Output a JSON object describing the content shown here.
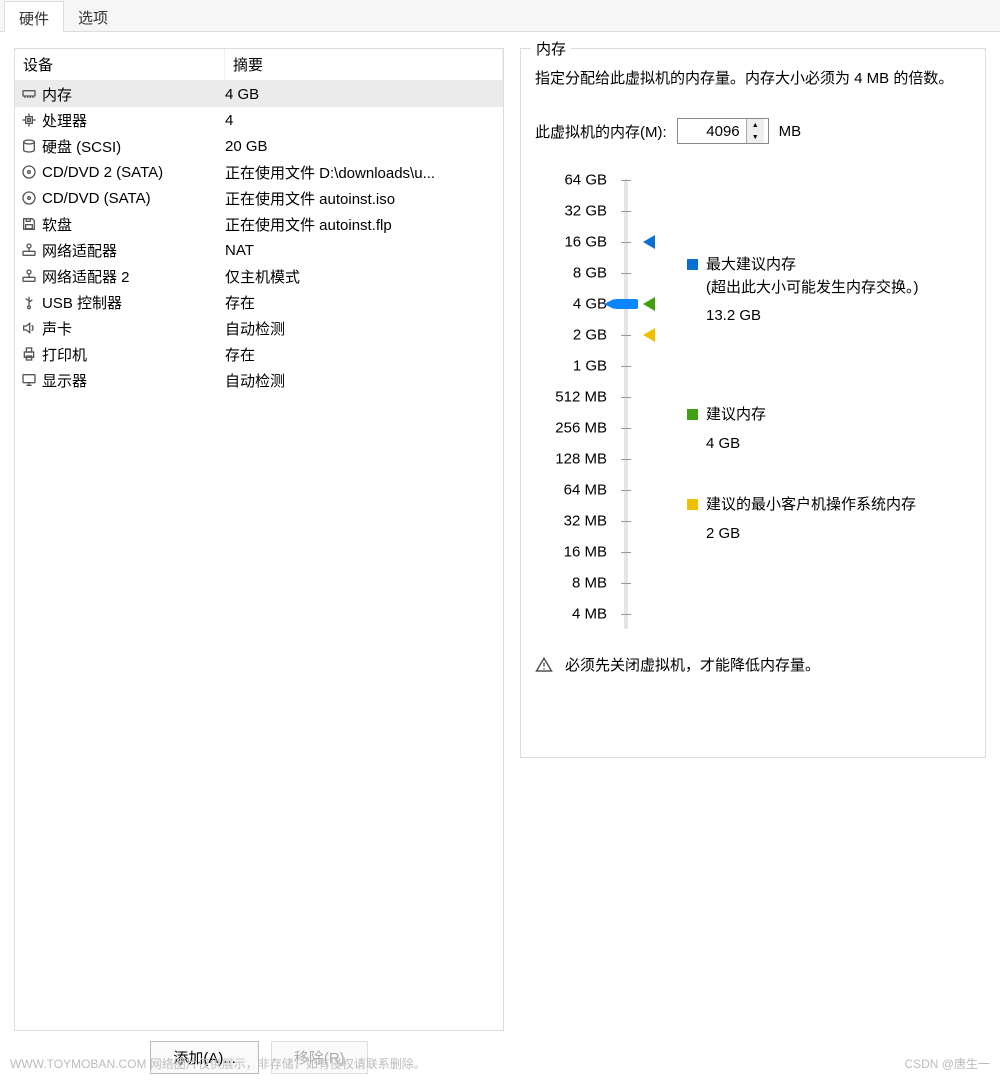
{
  "tabs": {
    "hardware": "硬件",
    "options": "选项"
  },
  "hw_headers": {
    "device": "设备",
    "summary": "摘要"
  },
  "hardware": [
    {
      "icon": "memory-icon",
      "name": "内存",
      "summary": "4 GB",
      "selected": true
    },
    {
      "icon": "cpu-icon",
      "name": "处理器",
      "summary": "4"
    },
    {
      "icon": "disk-icon",
      "name": "硬盘 (SCSI)",
      "summary": "20 GB"
    },
    {
      "icon": "cd-icon",
      "name": "CD/DVD 2 (SATA)",
      "summary": "正在使用文件 D:\\downloads\\u..."
    },
    {
      "icon": "cd-icon",
      "name": "CD/DVD (SATA)",
      "summary": "正在使用文件 autoinst.iso"
    },
    {
      "icon": "floppy-icon",
      "name": "软盘",
      "summary": "正在使用文件 autoinst.flp"
    },
    {
      "icon": "network-icon",
      "name": "网络适配器",
      "summary": "NAT"
    },
    {
      "icon": "network-icon",
      "name": "网络适配器 2",
      "summary": "仅主机模式"
    },
    {
      "icon": "usb-icon",
      "name": "USB 控制器",
      "summary": "存在"
    },
    {
      "icon": "sound-icon",
      "name": "声卡",
      "summary": "自动检测"
    },
    {
      "icon": "printer-icon",
      "name": "打印机",
      "summary": "存在"
    },
    {
      "icon": "display-icon",
      "name": "显示器",
      "summary": "自动检测"
    }
  ],
  "buttons": {
    "add": "添加(A)...",
    "remove": "移除(R)"
  },
  "memory_panel": {
    "legend": "内存",
    "desc": "指定分配给此虚拟机的内存量。内存大小必须为 4 MB 的倍数。",
    "input_label": "此虚拟机的内存(M):",
    "value": "4096",
    "unit": "MB",
    "ticks": [
      "64 GB",
      "32 GB",
      "16 GB",
      "8 GB",
      "4 GB",
      "2 GB",
      "1 GB",
      "512 MB",
      "256 MB",
      "128 MB",
      "64 MB",
      "32 MB",
      "16 MB",
      "8 MB",
      "4 MB"
    ],
    "markers": {
      "max": {
        "color": "blue",
        "tick_index": 2,
        "label": "最大建议内存",
        "note": "(超出此大小可能发生内存交换。)",
        "value": "13.2 GB"
      },
      "rec": {
        "color": "green",
        "tick_index": 4,
        "label": "建议内存",
        "value": "4 GB"
      },
      "min": {
        "color": "yellow",
        "tick_index": 5,
        "label": "建议的最小客户机操作系统内存",
        "value": "2 GB"
      }
    },
    "handle_tick_index": 4,
    "warning": "必须先关闭虚拟机，才能降低内存量。"
  },
  "footer": {
    "left": "WWW.TOYMOBAN.COM 网络图片仅供展示，非存储，如有侵权请联系删除。",
    "right": "CSDN @唐生一"
  }
}
